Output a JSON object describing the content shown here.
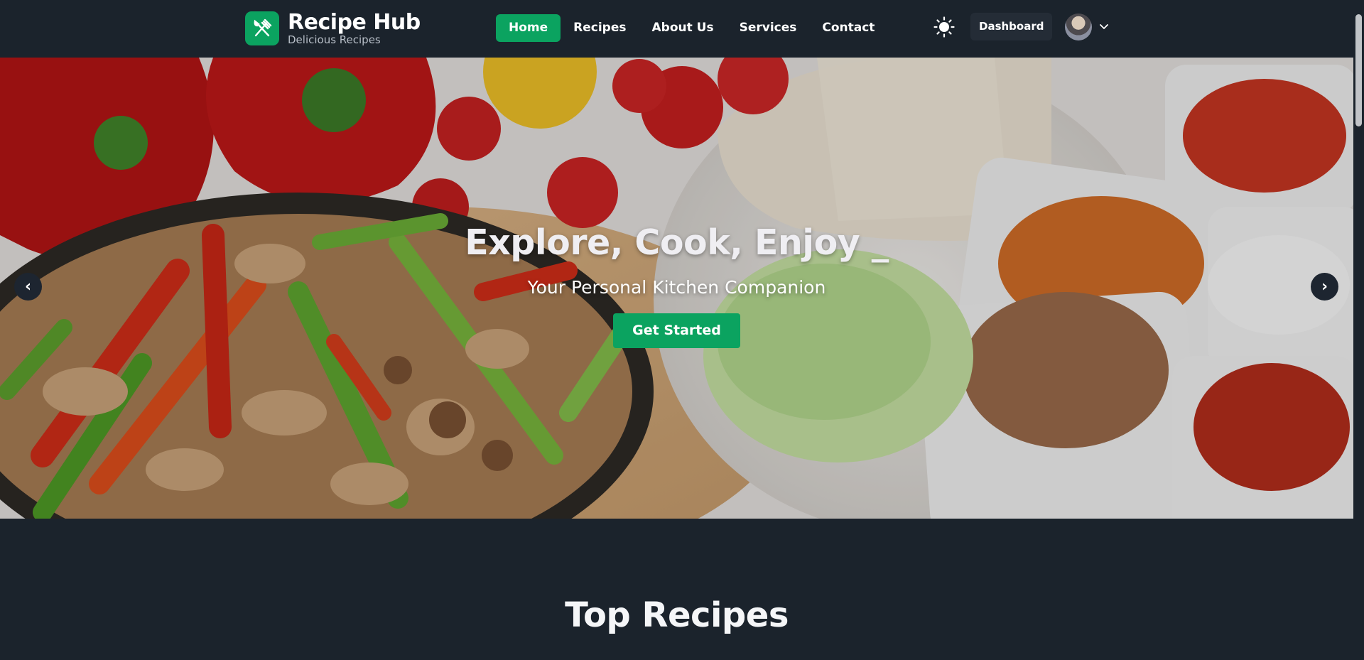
{
  "brand": {
    "title": "Recipe Hub",
    "subtitle": "Delicious Recipes",
    "logo_icon": "fork-knife-icon",
    "accent_color": "#0ba360"
  },
  "nav": {
    "items": [
      {
        "label": "Home",
        "active": true
      },
      {
        "label": "Recipes",
        "active": false
      },
      {
        "label": "About Us",
        "active": false
      },
      {
        "label": "Services",
        "active": false
      },
      {
        "label": "Contact",
        "active": false
      }
    ]
  },
  "header_right": {
    "theme_icon": "sun-icon",
    "dashboard_label": "Dashboard",
    "avatar_icon": "user-avatar",
    "menu_icon": "chevron-down-icon"
  },
  "hero": {
    "title": "Explore, Cook, Enjoy _",
    "subtitle": "Your Personal Kitchen Companion",
    "cta_label": "Get Started",
    "prev_label": "‹",
    "next_label": "›"
  },
  "section": {
    "title": "Top Recipes"
  }
}
